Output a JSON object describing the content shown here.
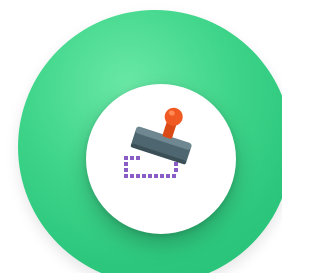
{
  "app_icon": {
    "icon": "stamp-icon",
    "colors": {
      "outer_ring": "#3fd58a",
      "inner_disc": "#ffffff",
      "stamp_body": "#4e6670",
      "stamp_handle": "#f05a22",
      "dotted_frame": "#8a5cc6"
    }
  }
}
